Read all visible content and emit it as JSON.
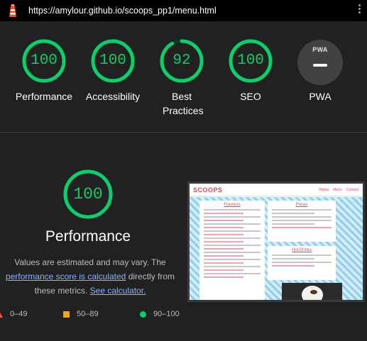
{
  "browser": {
    "url": "https://amylour.github.io/scoops_pp1/menu.html"
  },
  "colors": {
    "pass": "#0cce6b",
    "average": "#ffa400",
    "fail": "#ff4e42",
    "background": "#212121"
  },
  "categories": [
    {
      "label": "Performance",
      "score": "100",
      "fraction": 1.0
    },
    {
      "label": "Accessibility",
      "score": "100",
      "fraction": 1.0
    },
    {
      "label": "Best Practices",
      "score": "92",
      "fraction": 0.92
    },
    {
      "label": "SEO",
      "score": "100",
      "fraction": 1.0
    },
    {
      "label": "PWA",
      "badge_text": "PWA",
      "icon": "pwa-badge-icon"
    }
  ],
  "performance": {
    "score": "100",
    "fraction": 1.0,
    "title": "Performance",
    "desc_prefix": "Values are estimated and may vary. The ",
    "link_score": "performance score is calculated",
    "desc_middle": " directly from these metrics. ",
    "link_calculator": "See calculator."
  },
  "legend": [
    {
      "range": "0–49",
      "icon": "fail-triangle-icon"
    },
    {
      "range": "50–89",
      "icon": "average-square-icon"
    },
    {
      "range": "90–100",
      "icon": "pass-circle-icon"
    }
  ],
  "screenshot": {
    "brand": "SCOOPS",
    "nav": [
      "Home",
      "Menu",
      "Contact"
    ],
    "flavours_title": "Flavours",
    "prices_title": "Prices",
    "hot_title": "Hot Drinks"
  }
}
